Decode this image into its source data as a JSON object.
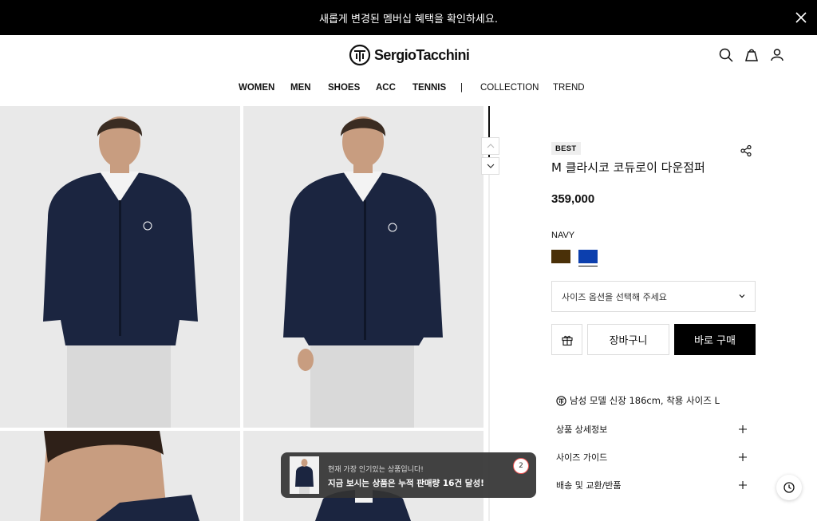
{
  "banner": {
    "text": "새롭게 변경된 멤버십 혜택을 확인하세요.",
    "close_icon": "close-icon"
  },
  "brand": {
    "name": "SergioTacchini"
  },
  "header_icons": [
    "search-icon",
    "bag-icon",
    "user-icon"
  ],
  "nav": {
    "items": [
      {
        "label": "WOMEN"
      },
      {
        "label": "MEN"
      },
      {
        "label": "SHOES"
      },
      {
        "label": "ACC"
      },
      {
        "label": "TENNIS"
      },
      {
        "label": "|"
      },
      {
        "label": "COLLECTION"
      },
      {
        "label": "TREND"
      }
    ]
  },
  "product": {
    "badge": "BEST",
    "name": "M 클라시코 코듀로이 다운점퍼",
    "price": "359,000",
    "color_label": "NAVY",
    "swatches": [
      {
        "name": "brown",
        "color": "#4a3008",
        "selected": false
      },
      {
        "name": "navy",
        "color": "#0c3fae",
        "selected": true
      }
    ],
    "size_placeholder": "사이즈 옵션을 선택해 주세요",
    "cart_label": "장바구니",
    "buy_label": "바로 구매",
    "model_info": "남성 모델 신장 186cm, 착용 사이즈 L",
    "accordion": [
      {
        "label": "상품 상세정보"
      },
      {
        "label": "사이즈 가이드"
      },
      {
        "label": "배송 및 교환/반품"
      }
    ]
  },
  "toast": {
    "subtitle": "현재 가장 인기있는 상품입니다!",
    "message": "지금 보시는 상품은 누적 판매량 16건 달성!",
    "count": "2"
  },
  "colors": {
    "accent": "#000000",
    "banner_bg": "#000000",
    "navy": "#0c3fae",
    "brown": "#4a3008"
  }
}
